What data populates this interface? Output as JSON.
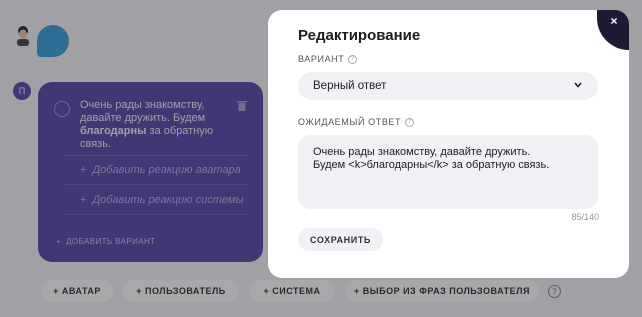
{
  "background": {
    "avatar_initial": "П",
    "message": {
      "text_before": "Очень рады знакомству, давайте дружить. Будем ",
      "text_bold": "благодарны",
      "text_after": " за обратную связь."
    },
    "add_avatar_reaction": "Добавить реакцию аватара",
    "add_system_reaction": "Добавить реакцию системы",
    "add_variant": "ДОБАВИТЬ ВАРИАНТ",
    "bottom_buttons": [
      {
        "label": "+ АВАТАР"
      },
      {
        "label": "+ ПОЛЬЗОВАТЕЛЬ"
      },
      {
        "label": "+ СИСТЕМА"
      },
      {
        "label": "+ ВЫБОР ИЗ ФРАЗ ПОЛЬЗОВАТЕЛЯ"
      }
    ]
  },
  "modal": {
    "title": "Редактирование",
    "variant_label": "ВАРИАНТ",
    "variant_value": "Верный ответ",
    "expected_label": "ОЖИДАЕМЫЙ ОТВЕТ",
    "expected_value": "Очень рады знакомству, давайте дружить.\nБудем <k>благодарны</k> за обратную связь.",
    "counter": "85/140",
    "save_label": "СОХРАНИТЬ",
    "close_glyph": "×",
    "help_glyph": "?"
  },
  "colors": {
    "card": "#5b4aa8",
    "corner": "#1e1a33",
    "field_bg": "#f0f0f5"
  }
}
